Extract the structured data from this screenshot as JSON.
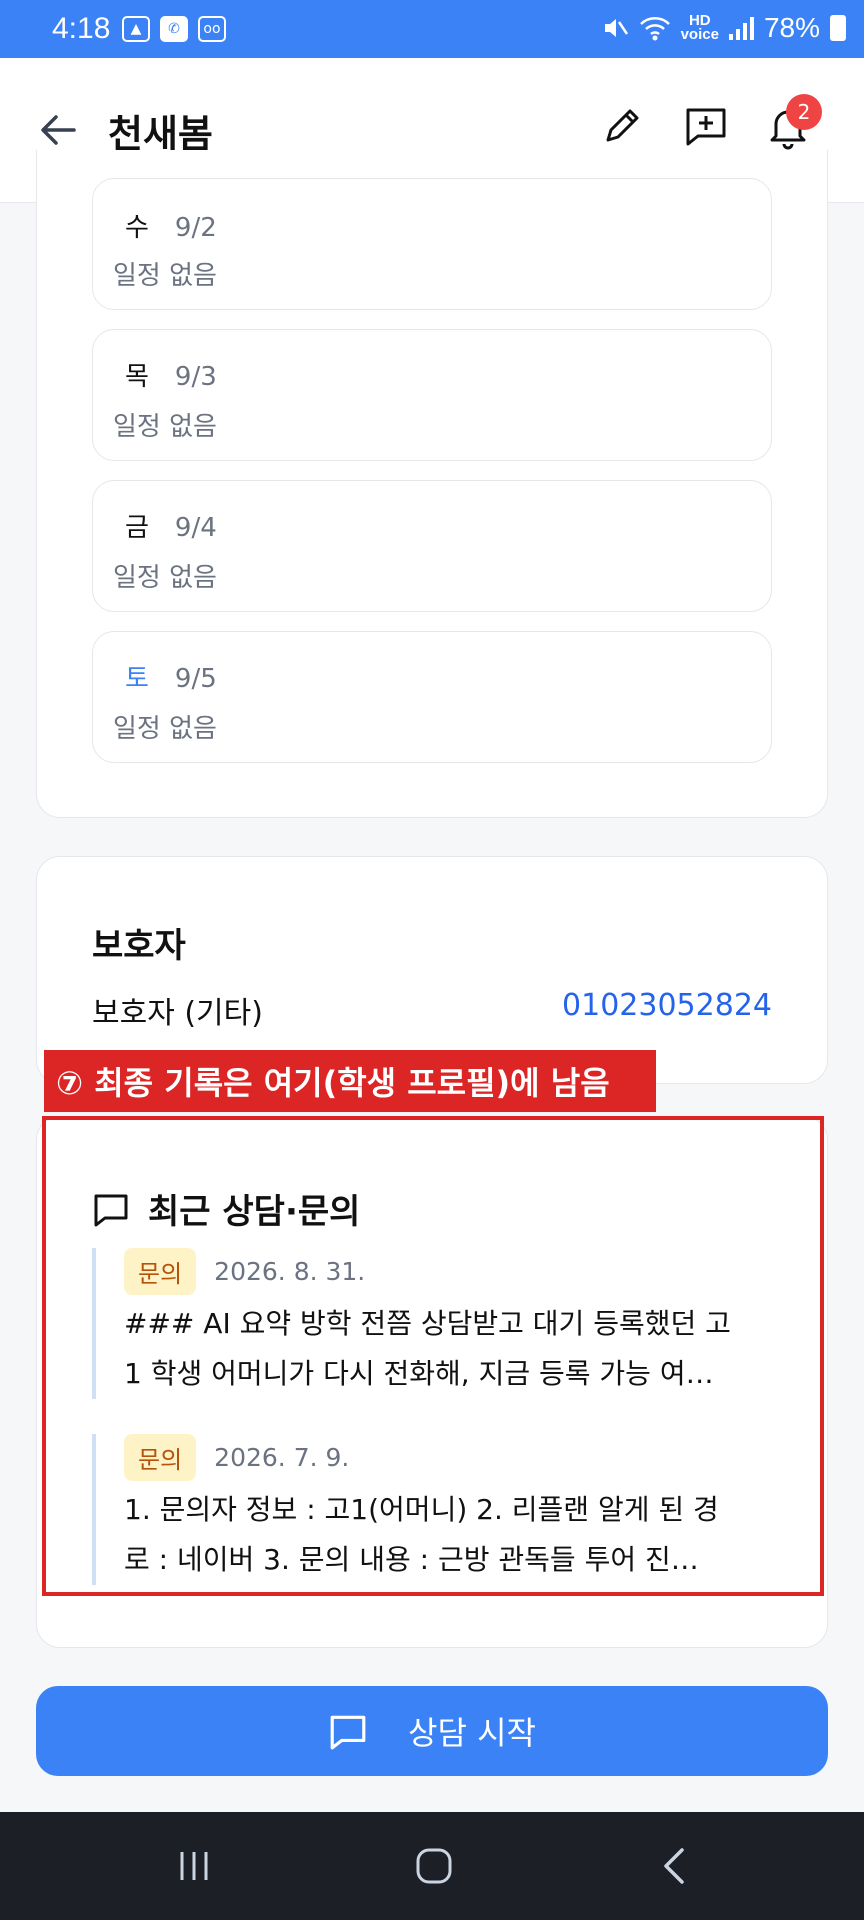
{
  "status_bar": {
    "time": "4:18",
    "hd_label": "HD\nvoice",
    "battery": "78%"
  },
  "app_bar": {
    "title": "천새봄",
    "notification_count": "2"
  },
  "schedule": [
    {
      "day": "수",
      "date": "9/2",
      "text": "일정 없음"
    },
    {
      "day": "목",
      "date": "9/3",
      "text": "일정 없음"
    },
    {
      "day": "금",
      "date": "9/4",
      "text": "일정 없음"
    },
    {
      "day": "토",
      "date": "9/5",
      "text": "일정 없음"
    }
  ],
  "guardian": {
    "title": "보호자",
    "name": "보호자 (기타)",
    "phone": "01023052824"
  },
  "annotation": {
    "label": "⑦ 최종 기록은 여기(학생 프로필)에 남음"
  },
  "consults": {
    "title": "최근 상담·문의",
    "items": [
      {
        "tag": "문의",
        "date": "2026. 8. 31.",
        "text": "### AI 요약 방학 전쯤 상담받고 대기 등록했던 고\n1 학생 어머니가 다시 전화해, 지금 등록 가능 여…"
      },
      {
        "tag": "문의",
        "date": "2026. 7. 9.",
        "text": "1. 문의자 정보 : 고1(어머니) 2. 리플랜 알게 된 경\n로 : 네이버 3. 문의 내용 : 근방 관독들 투어 진…"
      }
    ]
  },
  "cta": {
    "label": "상담 시작"
  },
  "colors": {
    "primary": "#3b82f6",
    "annotation": "#dc2626",
    "tag_bg": "#fef3c7",
    "tag_text": "#b45309"
  }
}
